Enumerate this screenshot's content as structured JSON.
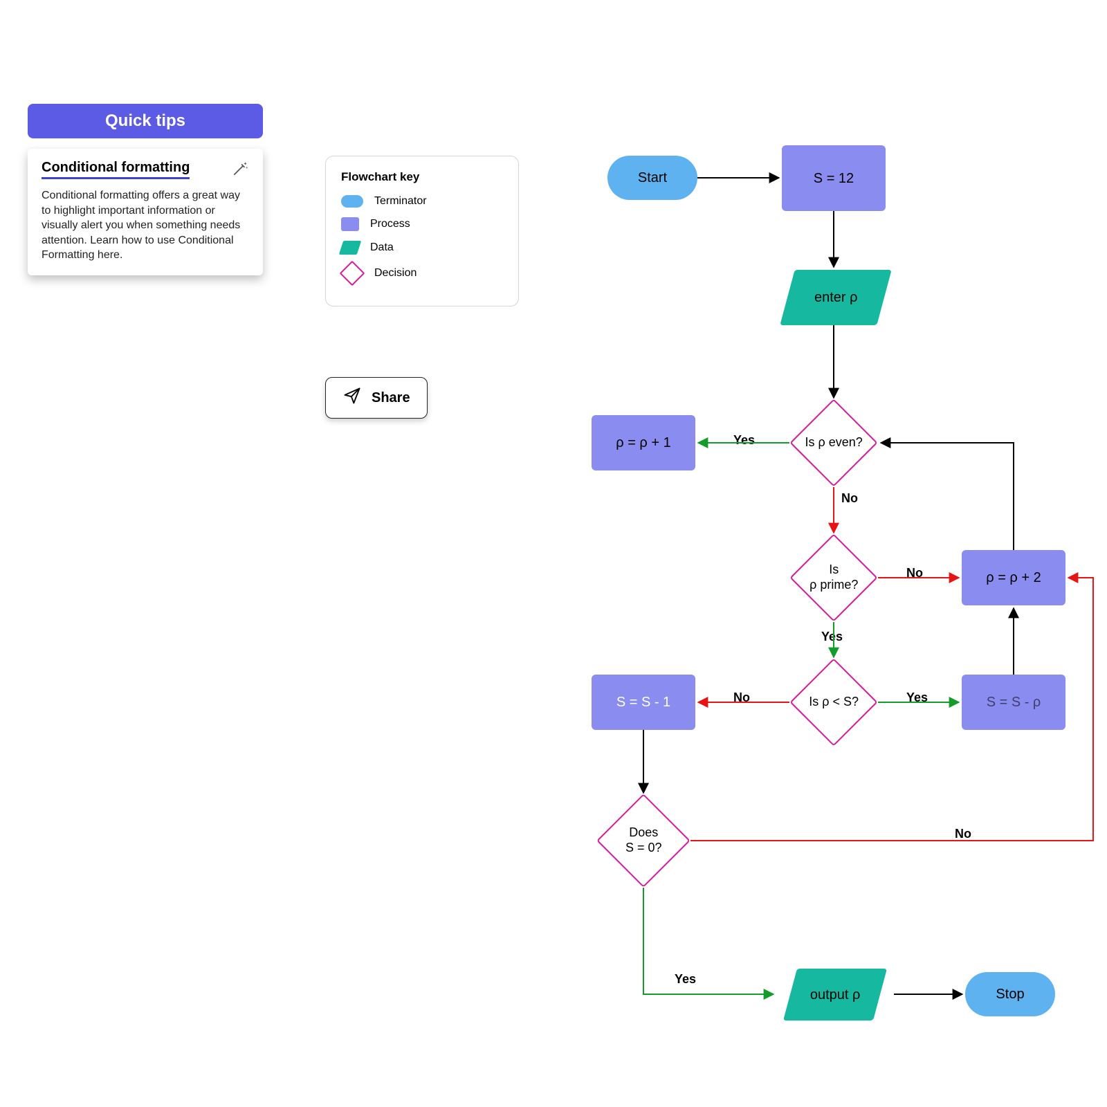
{
  "tips": {
    "header": "Quick tips",
    "title": "Conditional formatting",
    "body": "Conditional formatting offers a great way to highlight important information or visually alert you when something needs attention. Learn how to use Conditional Formatting here."
  },
  "legend": {
    "title": "Flowchart key",
    "items": [
      {
        "label": "Terminator"
      },
      {
        "label": "Process"
      },
      {
        "label": "Data"
      },
      {
        "label": "Decision"
      }
    ]
  },
  "share": {
    "label": "Share"
  },
  "colors": {
    "accent": "#5b5be6",
    "terminator": "#5eb2ef",
    "process": "#8a8cf0",
    "data": "#16b9a0",
    "decision_border": "#d81b9b",
    "edge_black": "#000000",
    "edge_green": "#149c2b",
    "edge_red": "#e81313"
  },
  "flow": {
    "nodes": {
      "start": {
        "label": "Start"
      },
      "s12": {
        "label": "S = 12"
      },
      "enter_rho": {
        "label": "enter ρ"
      },
      "is_even": {
        "label": "Is ρ even?"
      },
      "rho_plus1": {
        "label": "ρ = ρ + 1"
      },
      "is_prime": {
        "label": "Is\nρ prime?"
      },
      "rho_plus2": {
        "label": "ρ = ρ + 2"
      },
      "is_lt": {
        "label": "Is ρ < S?"
      },
      "s_minus1": {
        "label": "S = S - 1"
      },
      "s_minus_rho": {
        "label": "S = S - ρ"
      },
      "s_zero": {
        "label": "Does\nS = 0?"
      },
      "output": {
        "label": "output ρ"
      },
      "stop": {
        "label": "Stop"
      }
    },
    "edge_labels": {
      "yes": "Yes",
      "no": "No"
    }
  }
}
